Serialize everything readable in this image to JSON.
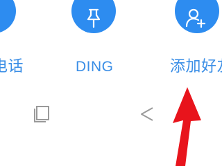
{
  "theme": {
    "accent": "#2d8cf0",
    "label_color": "#3a8ee6",
    "nav_icon_color": "#9a9a9a",
    "arrow_color": "#e8141c"
  },
  "actions": [
    {
      "label": "电话",
      "icon": "phone-icon"
    },
    {
      "label": "DING",
      "icon": "pin-icon"
    },
    {
      "label": "添加好友",
      "icon": "add-user-icon"
    }
  ],
  "nav_bar": {
    "items": [
      {
        "icon": "recent-apps-icon"
      },
      {
        "icon": "back-icon"
      }
    ]
  },
  "annotation": {
    "icon": "red-arrow-icon"
  }
}
